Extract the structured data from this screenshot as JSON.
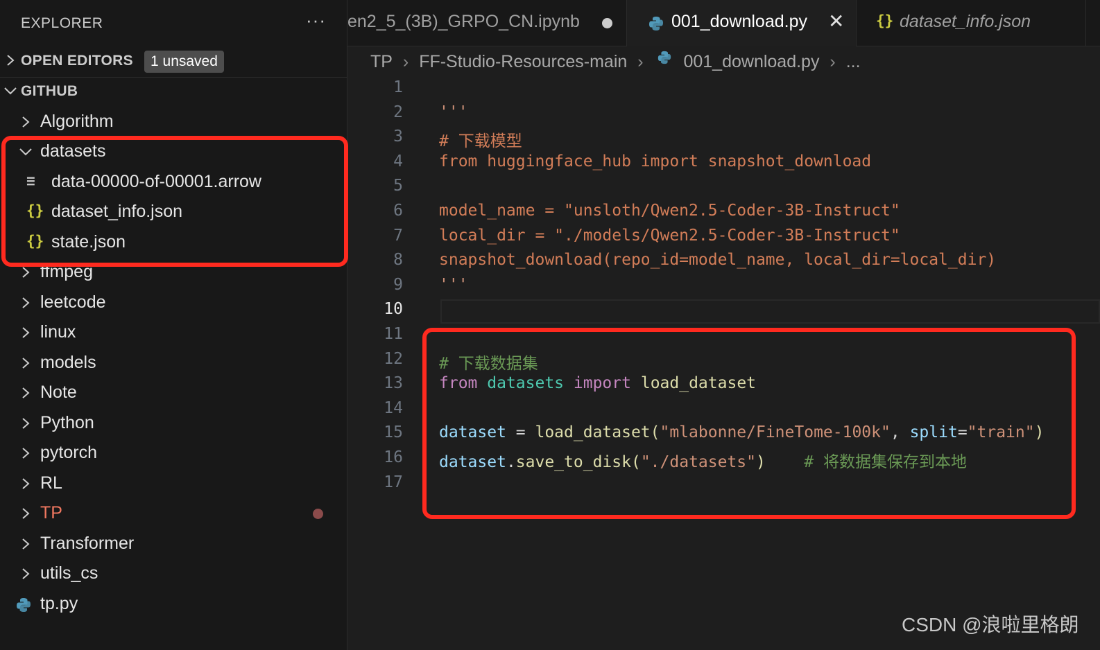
{
  "sidebar": {
    "title": "EXPLORER",
    "more": "···",
    "open_editors": {
      "label": "OPEN EDITORS",
      "badge": "1 unsaved"
    },
    "github": {
      "label": "GITHUB",
      "items": [
        {
          "name": "Algorithm"
        },
        {
          "name": "datasets"
        },
        {
          "name": "data-00000-of-00001.arrow"
        },
        {
          "name": "dataset_info.json"
        },
        {
          "name": "state.json"
        },
        {
          "name": "ffmpeg"
        },
        {
          "name": "leetcode"
        },
        {
          "name": "linux"
        },
        {
          "name": "models"
        },
        {
          "name": "Note"
        },
        {
          "name": "Python"
        },
        {
          "name": "pytorch"
        },
        {
          "name": "RL"
        },
        {
          "name": "TP"
        },
        {
          "name": "Transformer"
        },
        {
          "name": "utils_cs"
        },
        {
          "name": "tp.py"
        }
      ]
    }
  },
  "tabs": [
    {
      "label": "en2_5_(3B)_GRPO_CN.ipynb",
      "modified": true
    },
    {
      "label": "001_download.py",
      "active": true
    },
    {
      "label": "dataset_info.json"
    }
  ],
  "breadcrumb": {
    "parts": [
      "TP",
      "FF-Studio-Resources-main",
      "001_download.py",
      "..."
    ]
  },
  "code": {
    "line_numbers": [
      "1",
      "2",
      "3",
      "4",
      "5",
      "6",
      "7",
      "8",
      "9",
      "10",
      "11",
      "12",
      "13",
      "14",
      "15",
      "16",
      "17"
    ],
    "active_line": "10",
    "lines": {
      "l2": "'''",
      "l3": "# 下载模型",
      "l4": "from huggingface_hub import snapshot_download",
      "l6": "model_name = \"unsloth/Qwen2.5-Coder-3B-Instruct\"",
      "l7": "local_dir = \"./models/Qwen2.5-Coder-3B-Instruct\"",
      "l8": "snapshot_download(repo_id=model_name, local_dir=local_dir)",
      "l9": "'''",
      "l12": "# 下载数据集",
      "l13_from": "from",
      "l13_mod": "datasets",
      "l13_import": "import",
      "l13_fn": "load_dataset",
      "l15_var": "dataset",
      "l15_eq": " = ",
      "l15_fn": "load_dataset",
      "l15_p1": "(",
      "l15_s1": "\"mlabonne/FineTome-100k\"",
      "l15_comma": ", ",
      "l15_kw": "split",
      "l15_eq2": "=",
      "l15_s2": "\"train\"",
      "l15_p2": ")",
      "l16_var": "dataset",
      "l16_dot": ".",
      "l16_fn": "save_to_disk",
      "l16_p1": "(",
      "l16_s": "\"./datasets\"",
      "l16_p2": ")",
      "l16_cmt": "    # 将数据集保存到本地"
    }
  },
  "watermark": "CSDN @浪啦里格朗",
  "colors": {
    "highlight": "#ff2a1f",
    "accent_folder_tp": "#f07860"
  }
}
